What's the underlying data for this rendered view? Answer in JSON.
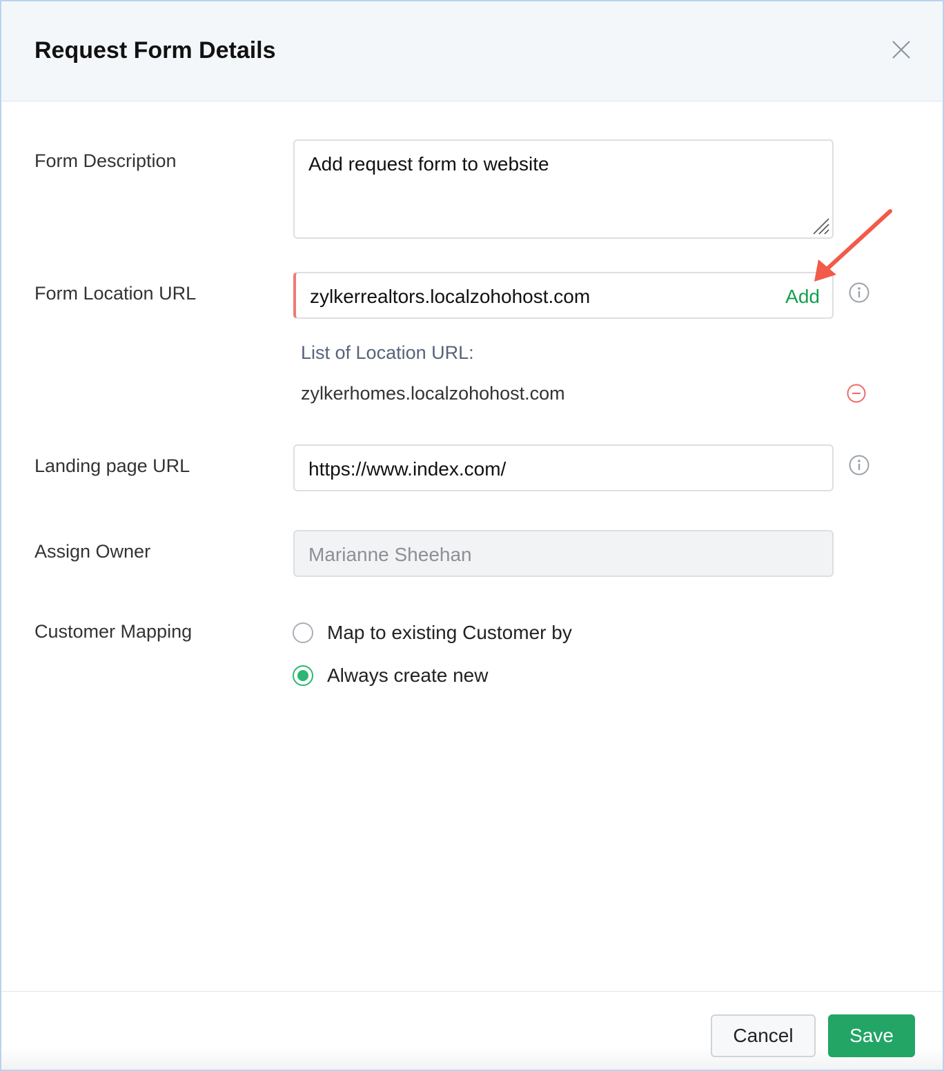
{
  "modal": {
    "title": "Request Form Details",
    "close_icon": "close-icon"
  },
  "form": {
    "description": {
      "label": "Form Description",
      "value": "Add request form to website"
    },
    "location_url": {
      "label": "Form Location URL",
      "value": "zylkerrealtors.localzohohost.com",
      "add_label": "Add",
      "info_icon": "info-icon",
      "list_title": "List of Location URL:",
      "items": [
        "zylkerhomes.localzohohost.com"
      ],
      "remove_icon": "minus-circle-icon"
    },
    "landing_url": {
      "label": "Landing page URL",
      "value": "https://www.index.com/",
      "info_icon": "info-icon"
    },
    "owner": {
      "label": "Assign Owner",
      "value": "Marianne Sheehan"
    },
    "customer_mapping": {
      "label": "Customer Mapping",
      "options": [
        {
          "label": "Map to existing Customer by",
          "selected": false
        },
        {
          "label": "Always create new",
          "selected": true
        }
      ]
    }
  },
  "footer": {
    "cancel_label": "Cancel",
    "save_label": "Save"
  },
  "colors": {
    "accent_green": "#22a565",
    "add_link": "#13a04e",
    "remove_red": "#f06a6a",
    "annotation_arrow": "#f25a4a"
  }
}
